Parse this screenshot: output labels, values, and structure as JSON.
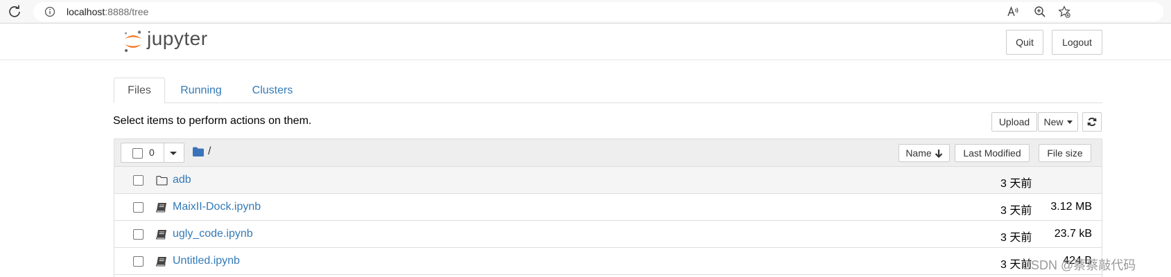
{
  "browser": {
    "url_host": "localhost",
    "url_rest": ":8888/tree"
  },
  "header": {
    "logo_text": "jupyter",
    "quit_label": "Quit",
    "logout_label": "Logout"
  },
  "tabs": [
    {
      "label": "Files",
      "active": true
    },
    {
      "label": "Running",
      "active": false
    },
    {
      "label": "Clusters",
      "active": false
    }
  ],
  "toolbar": {
    "instructions": "Select items to perform actions on them.",
    "upload_label": "Upload",
    "new_label": "New"
  },
  "list_header": {
    "selected_count": "0",
    "path": "/",
    "name_label": "Name",
    "modified_label": "Last Modified",
    "size_label": "File size"
  },
  "files": [
    {
      "name": "adb",
      "type": "folder",
      "modified": "3 天前",
      "size": ""
    },
    {
      "name": "MaixII-Dock.ipynb",
      "type": "notebook",
      "modified": "3 天前",
      "size": "3.12 MB"
    },
    {
      "name": "ugly_code.ipynb",
      "type": "notebook",
      "modified": "3 天前",
      "size": "23.7 kB"
    },
    {
      "name": "Untitled.ipynb",
      "type": "notebook",
      "modified": "3 天前",
      "size": "424 B"
    }
  ],
  "watermark": "CSDN @蔡蔡敲代码",
  "colors": {
    "link": "#337ab7",
    "logo_orange": "#f37726",
    "folder_blue": "#3b73b9"
  }
}
